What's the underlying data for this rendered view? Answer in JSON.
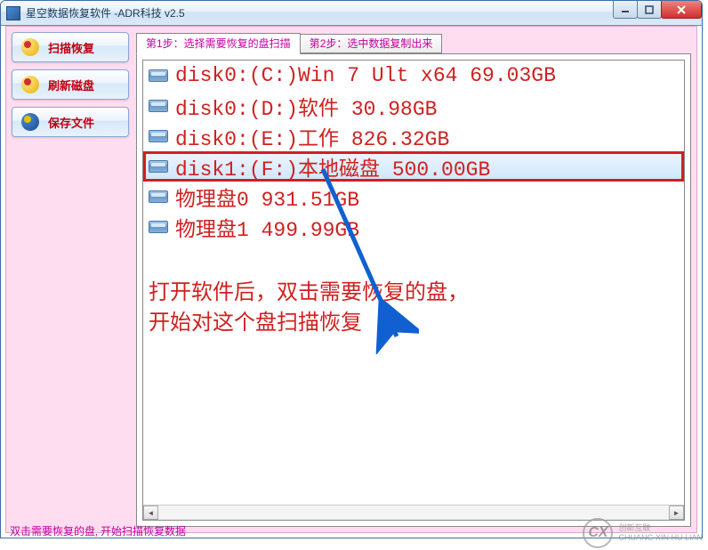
{
  "window": {
    "title": "星空数据恢复软件   -ADR科技 v2.5"
  },
  "sidebar": {
    "scan": "扫描恢复",
    "refresh": "刷新磁盘",
    "save": "保存文件"
  },
  "tabs": {
    "step1": "第1步：选择需要恢复的盘扫描",
    "step2": "第2步：选中数据复制出来"
  },
  "disks": [
    {
      "label": "disk0:(C:)Win 7 Ult x64 69.03GB",
      "selected": false
    },
    {
      "label": "disk0:(D:)软件 30.98GB",
      "selected": false
    },
    {
      "label": "disk0:(E:)工作 826.32GB",
      "selected": false
    },
    {
      "label": "disk1:(F:)本地磁盘 500.00GB",
      "selected": true
    },
    {
      "label": "物理盘0 931.51GB",
      "selected": false
    },
    {
      "label": "物理盘1 499.99GB",
      "selected": false
    }
  ],
  "annotation": {
    "line1": "打开软件后，双击需要恢复的盘，",
    "line2": "开始对这个盘扫描恢复"
  },
  "status": "双击需要恢复的盘, 开始扫描恢复数据",
  "watermark": {
    "logo": "CX",
    "line1": "创新互联",
    "line2": "CHUANG XIN HU LIAN"
  }
}
